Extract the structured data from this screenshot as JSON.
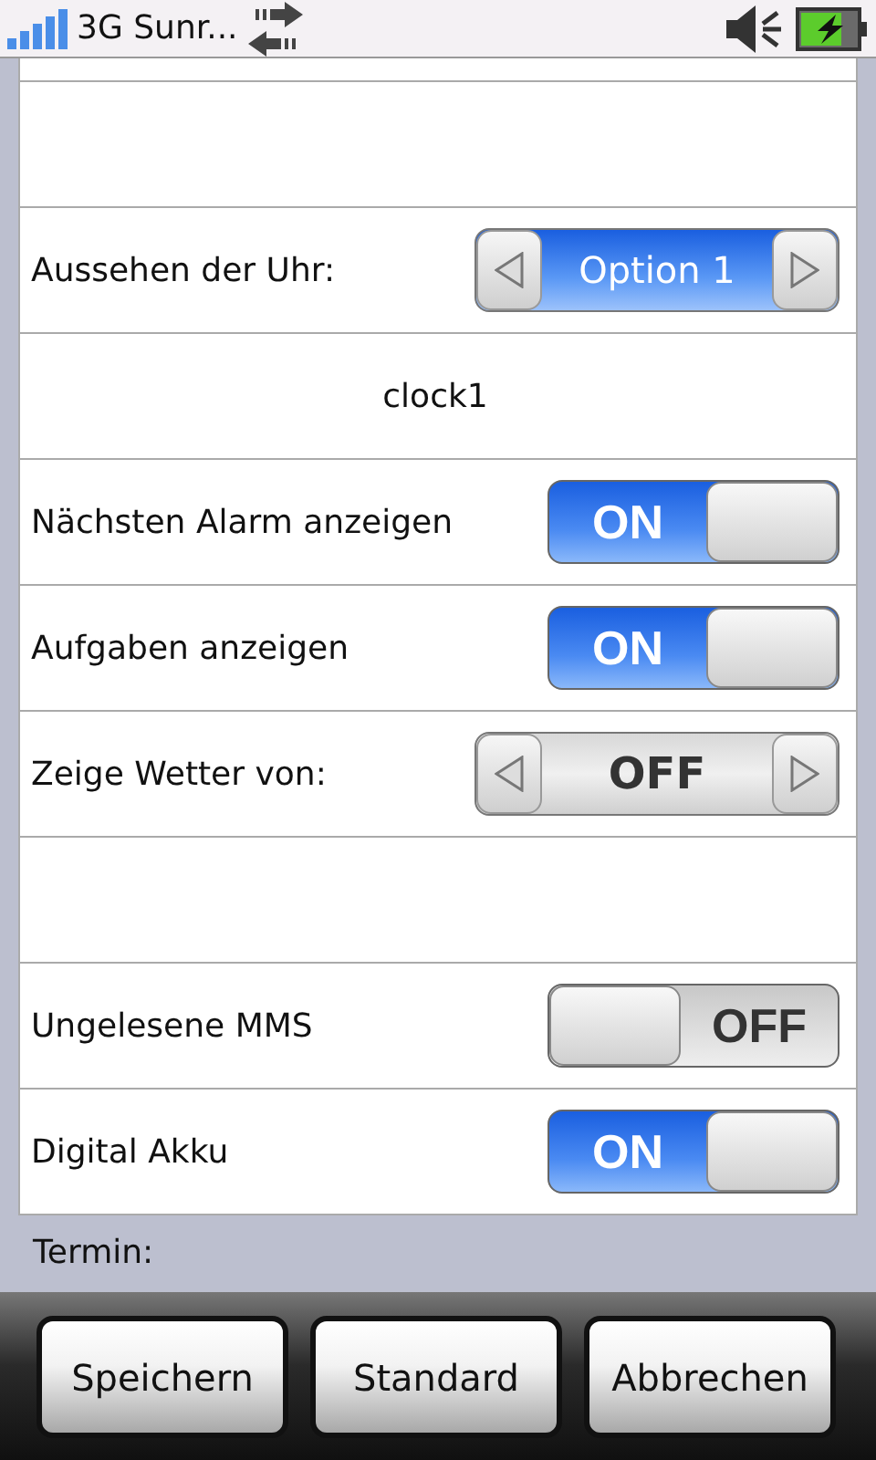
{
  "status_bar": {
    "carrier": "3G Sunr..."
  },
  "rows": [
    {
      "kind": "blank"
    },
    {
      "kind": "spinner",
      "label": "Aussehen der Uhr:",
      "value": "Option 1",
      "active": true
    },
    {
      "kind": "text",
      "text": "clock1"
    },
    {
      "kind": "toggle",
      "label": "Nächsten Alarm anzeigen",
      "on": true,
      "state_text": "ON"
    },
    {
      "kind": "toggle",
      "label": "Aufgaben anzeigen",
      "on": true,
      "state_text": "ON"
    },
    {
      "kind": "spinner",
      "label": "Zeige Wetter von:",
      "value": "OFF",
      "active": false
    },
    {
      "kind": "blank"
    },
    {
      "kind": "toggle",
      "label": "Ungelesene MMS",
      "on": false,
      "state_text": "OFF"
    },
    {
      "kind": "toggle",
      "label": "Digital Akku",
      "on": true,
      "state_text": "ON"
    }
  ],
  "section_label": "Termin:",
  "buttons": [
    "Speichern",
    "Standard",
    "Abbrechen"
  ]
}
